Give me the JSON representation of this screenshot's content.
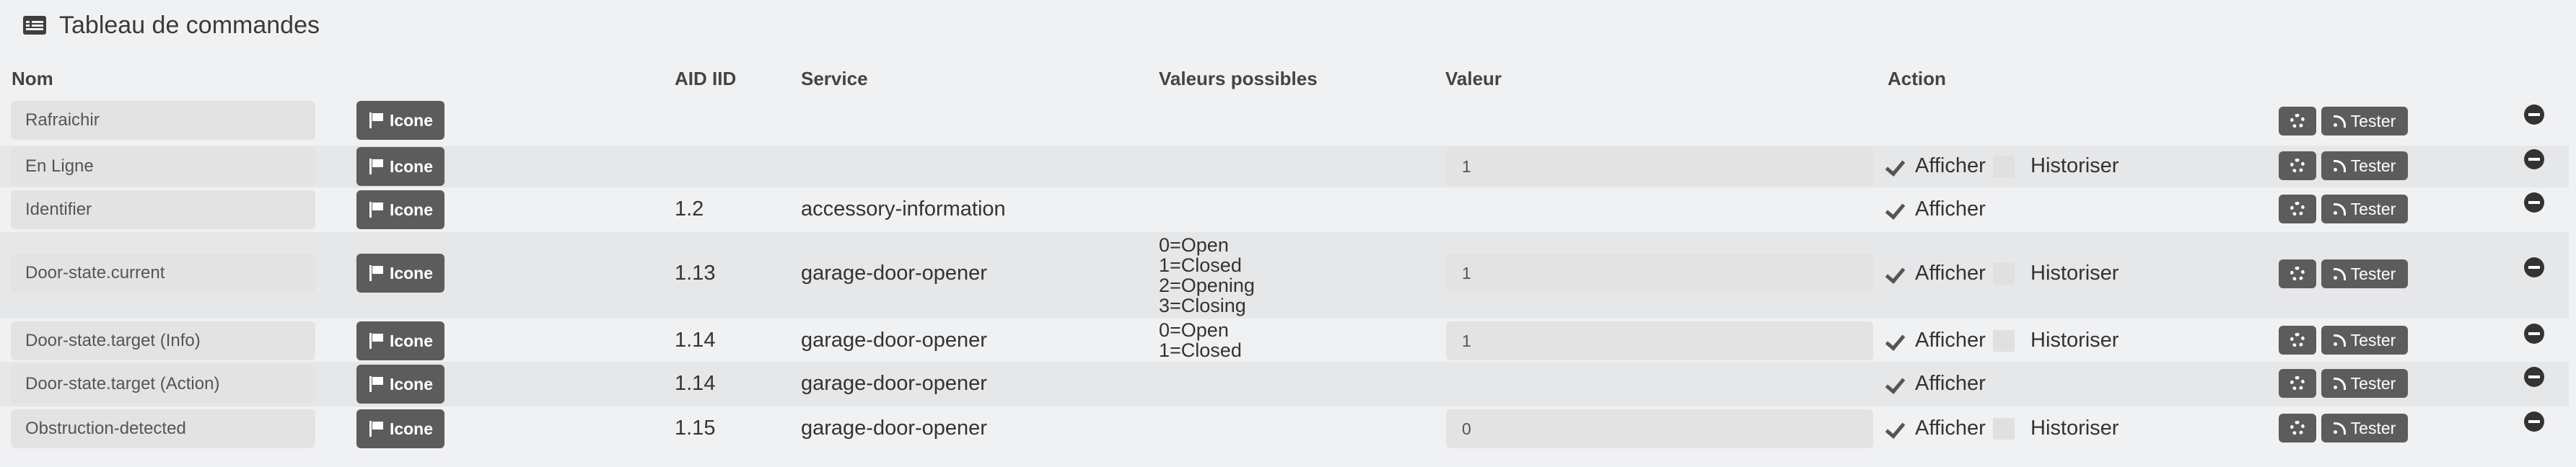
{
  "title": "Tableau de commandes",
  "headers": {
    "nom": "Nom",
    "aid_iid": "AID IID",
    "service": "Service",
    "valeurs": "Valeurs possibles",
    "valeur": "Valeur",
    "action": "Action"
  },
  "labels": {
    "icone": "Icone",
    "afficher": "Afficher",
    "historiser": "Historiser",
    "tester": "Tester"
  },
  "rows": [
    {
      "name": "Rafraichir",
      "aid": "",
      "service": "",
      "possible": [],
      "value": "",
      "afficher": false,
      "historiser": false
    },
    {
      "name": "En Ligne",
      "aid": "",
      "service": "",
      "possible": [],
      "value": "1",
      "afficher": true,
      "historiser": true
    },
    {
      "name": "Identifier",
      "aid": "1.2",
      "service": "accessory-information",
      "possible": [],
      "value": "",
      "afficher": true,
      "historiser": false
    },
    {
      "name": "Door-state.current",
      "aid": "1.13",
      "service": "garage-door-opener",
      "possible": [
        "0=Open",
        "1=Closed",
        "2=Opening",
        "3=Closing"
      ],
      "value": "1",
      "afficher": true,
      "historiser": true
    },
    {
      "name": "Door-state.target (Info)",
      "aid": "1.14",
      "service": "garage-door-opener",
      "possible": [
        "0=Open",
        "1=Closed"
      ],
      "value": "1",
      "afficher": true,
      "historiser": true
    },
    {
      "name": "Door-state.target (Action)",
      "aid": "1.14",
      "service": "garage-door-opener",
      "possible": [],
      "value": "",
      "afficher": true,
      "historiser": false
    },
    {
      "name": "Obstruction-detected",
      "aid": "1.15",
      "service": "garage-door-opener",
      "possible": [],
      "value": "0",
      "afficher": true,
      "historiser": true
    }
  ]
}
